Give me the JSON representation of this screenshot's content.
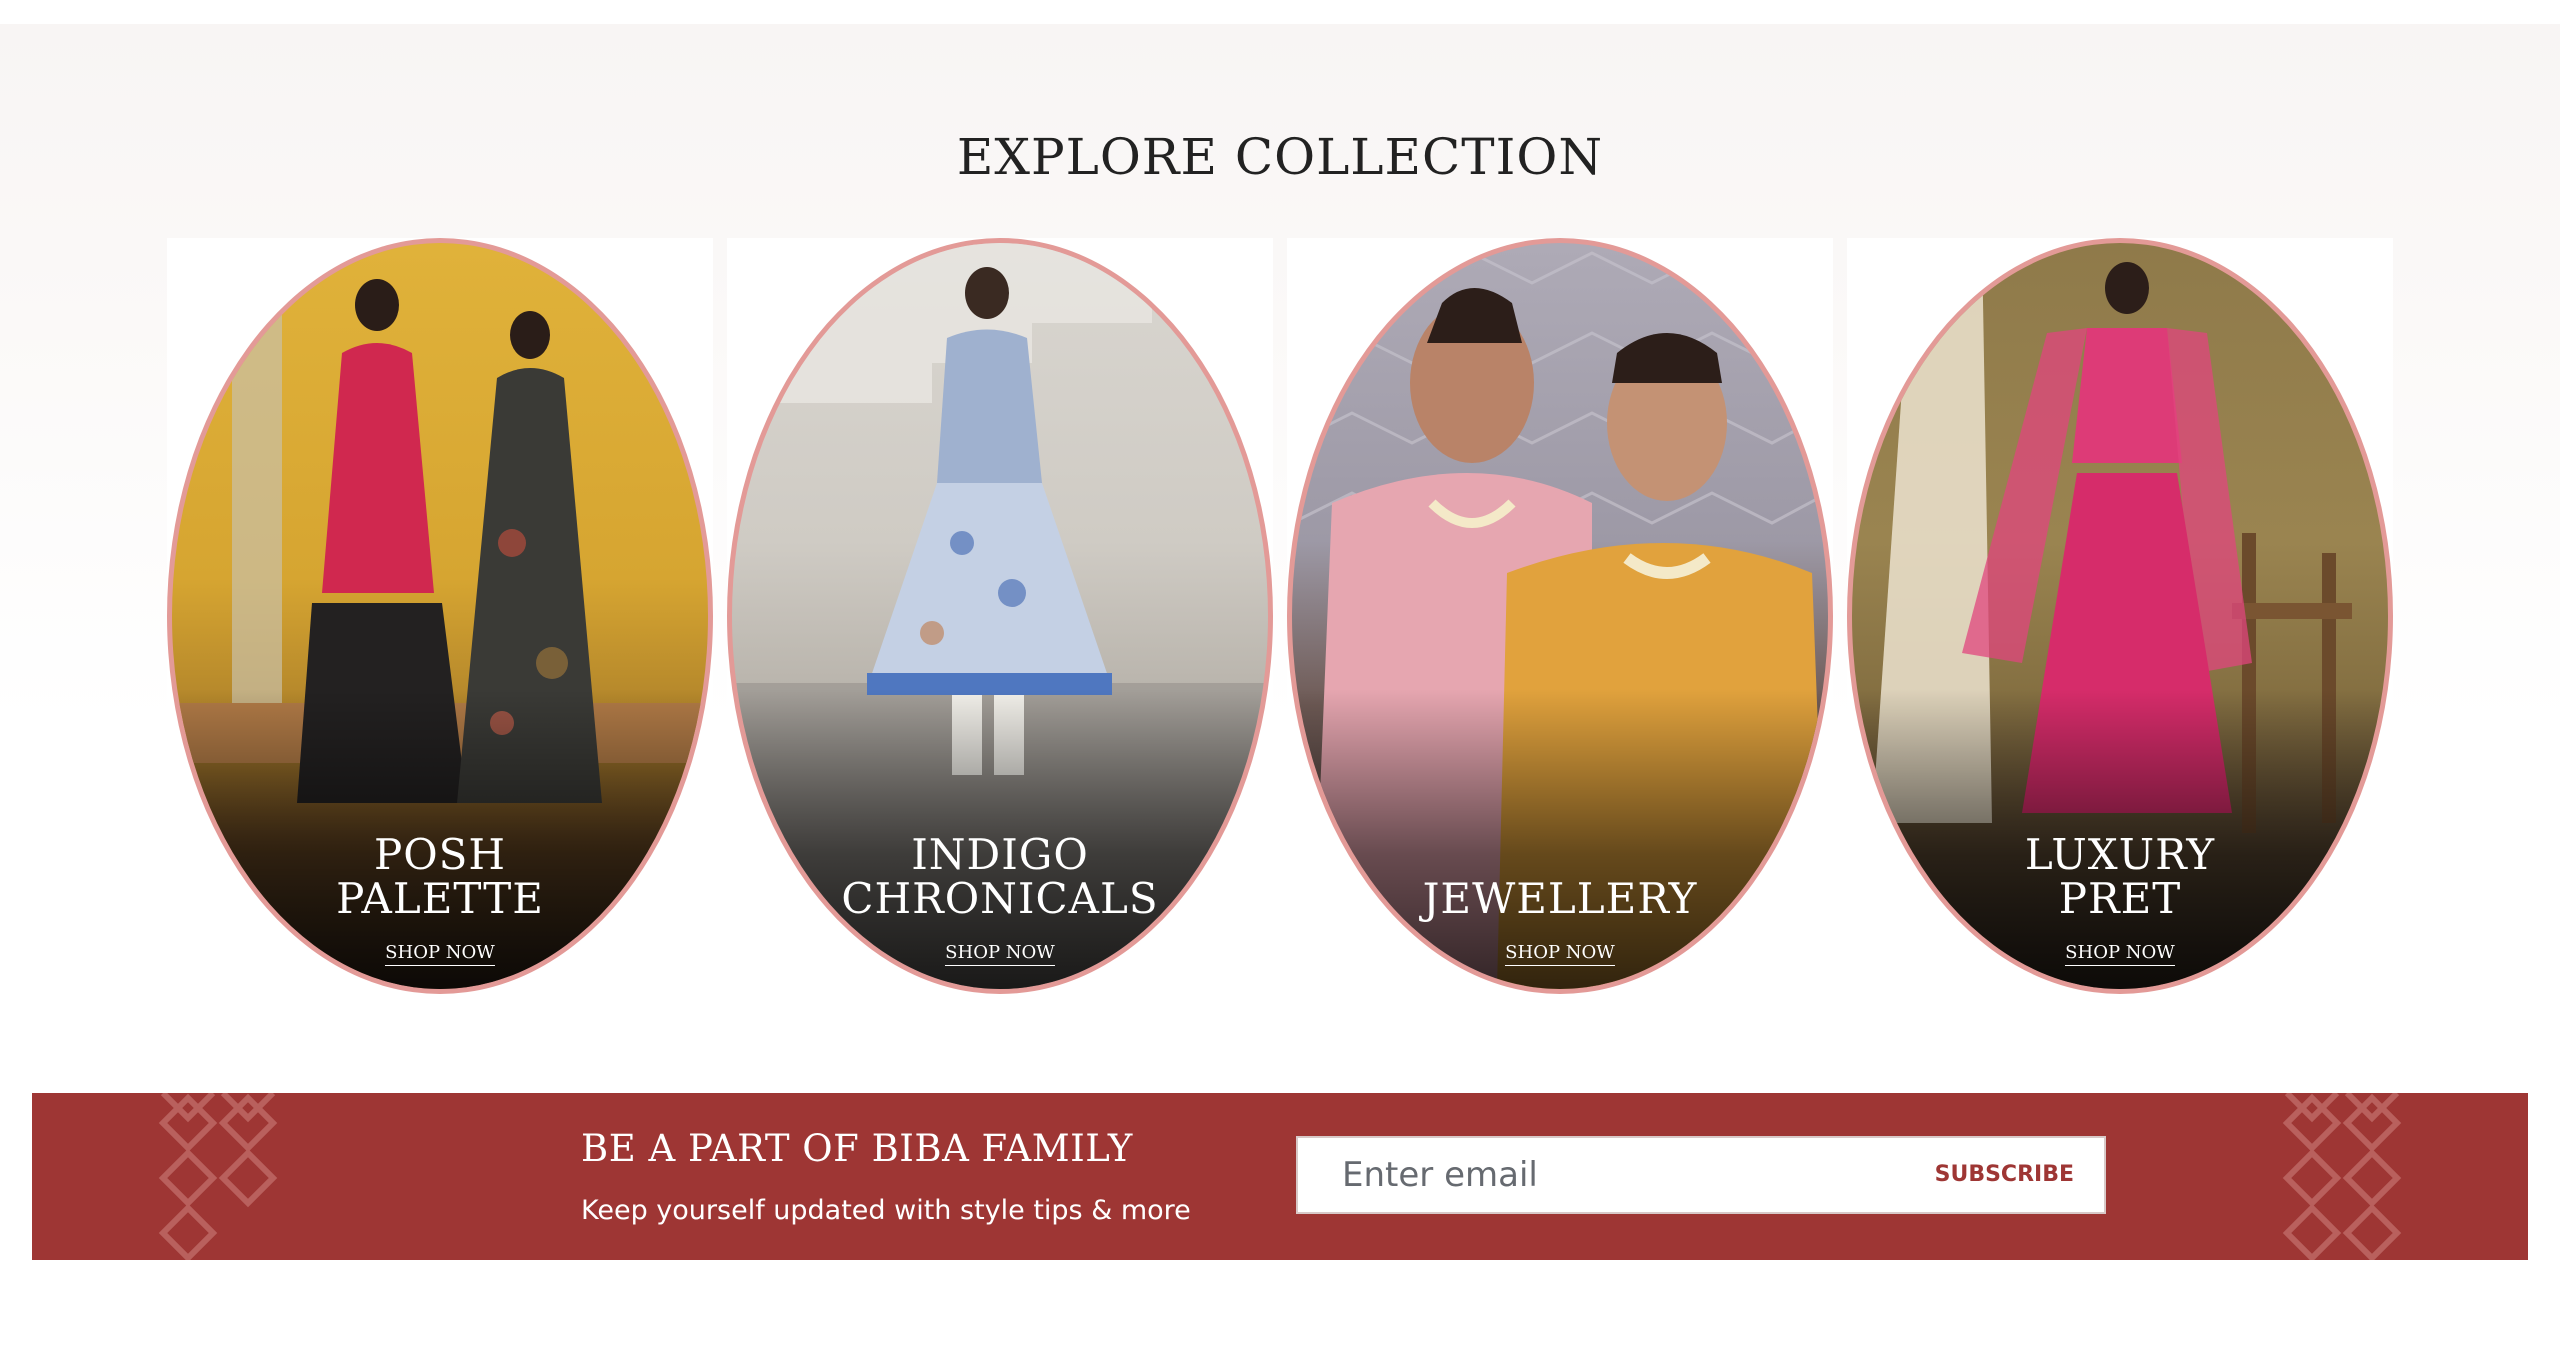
{
  "section": {
    "title": "EXPLORE COLLECTION"
  },
  "collections": [
    {
      "title": "POSH\nPALETTE",
      "cta": "SHOP NOW"
    },
    {
      "title": "INDIGO\nCHRONICALS",
      "cta": "SHOP NOW"
    },
    {
      "title": "JEWELLERY",
      "cta": "SHOP NOW"
    },
    {
      "title": "LUXURY\nPRET",
      "cta": "SHOP NOW"
    }
  ],
  "newsletter": {
    "title": "BE A PART OF BIBA FAMILY",
    "subtitle": "Keep yourself updated with style tips & more",
    "email_placeholder": "Enter email",
    "subscribe_label": "SUBSCRIBE"
  },
  "colors": {
    "brand_red": "#9e3634",
    "oval_border": "#e39a97"
  }
}
